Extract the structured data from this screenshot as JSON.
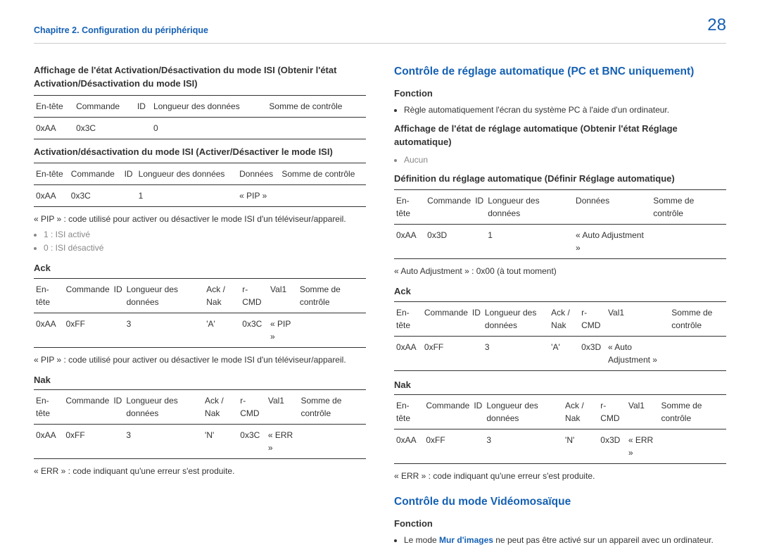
{
  "page_number": "28",
  "chapter": "Chapitre 2. Configuration du périphérique",
  "left": {
    "s1": {
      "title": "Affichage de l'état Activation/Désactivation du mode ISI (Obtenir l'état Activation/Désactivation du mode ISI)",
      "headers": [
        "En-tête",
        "Commande",
        "ID",
        "Longueur des données",
        "Somme de contrôle"
      ],
      "row": [
        "0xAA",
        "0x3C",
        "",
        "0",
        ""
      ]
    },
    "s2": {
      "title": "Activation/désactivation du mode ISI (Activer/Désactiver le mode ISI)",
      "headers": [
        "En-tête",
        "Commande",
        "ID",
        "Longueur des données",
        "Données",
        "Somme de contrôle"
      ],
      "row": [
        "0xAA",
        "0x3C",
        "",
        "1",
        "« PIP »",
        ""
      ],
      "note": "« PIP » : code utilisé pour activer ou désactiver le mode ISI d'un téléviseur/appareil.",
      "values": [
        "1 : ISI activé",
        "0 : ISI désactivé"
      ]
    },
    "ack": {
      "title": "Ack",
      "headers": [
        "En-tête",
        "Commande",
        "ID",
        "Longueur des données",
        "Ack / Nak",
        "r-CMD",
        "Val1",
        "Somme de contrôle"
      ],
      "row": [
        "0xAA",
        "0xFF",
        "",
        "3",
        "'A'",
        "0x3C",
        "« PIP »",
        ""
      ],
      "note": "« PIP » : code utilisé pour activer ou désactiver le mode ISI d'un téléviseur/appareil."
    },
    "nak": {
      "title": "Nak",
      "headers": [
        "En-tête",
        "Commande",
        "ID",
        "Longueur des données",
        "Ack / Nak",
        "r-CMD",
        "Val1",
        "Somme de contrôle"
      ],
      "row": [
        "0xAA",
        "0xFF",
        "",
        "3",
        "'N'",
        "0x3C",
        "« ERR »",
        ""
      ],
      "note": "« ERR » : code indiquant qu'une erreur s'est produite."
    }
  },
  "right": {
    "h1": "Contrôle de réglage automatique (PC et BNC uniquement)",
    "func": "Fonction",
    "func_item": "Règle automatiquement l'écran du système PC à l'aide d'un ordinateur.",
    "disp_title": "Affichage de l'état de réglage automatique (Obtenir l'état Réglage automatique)",
    "disp_item": "Aucun",
    "def": {
      "title": "Définition du réglage automatique (Définir Réglage automatique)",
      "headers": [
        "En-tête",
        "Commande",
        "ID",
        "Longueur des données",
        "Données",
        "Somme de contrôle"
      ],
      "row": [
        "0xAA",
        "0x3D",
        "",
        "1",
        "« Auto Adjustment »",
        ""
      ],
      "note": "« Auto Adjustment » : 0x00 (à tout moment)"
    },
    "ack": {
      "title": "Ack",
      "headers": [
        "En-tête",
        "Commande",
        "ID",
        "Longueur des données",
        "Ack / Nak",
        "r-CMD",
        "Val1",
        "Somme de contrôle"
      ],
      "row": [
        "0xAA",
        "0xFF",
        "",
        "3",
        "'A'",
        "0x3D",
        "« Auto Adjustment »",
        ""
      ]
    },
    "nak": {
      "title": "Nak",
      "headers": [
        "En-tête",
        "Commande",
        "ID",
        "Longueur des données",
        "Ack / Nak",
        "r-CMD",
        "Val1",
        "Somme de contrôle"
      ],
      "row": [
        "0xAA",
        "0xFF",
        "",
        "3",
        "'N'",
        "0x3D",
        "« ERR »",
        ""
      ],
      "note": "« ERR » : code indiquant qu'une erreur s'est produite."
    },
    "h2": "Contrôle du mode Vidéomosaïque",
    "func2": "Fonction",
    "func2_pre": "Le mode",
    "func2_link": "Mur d'images",
    "func2_post": "ne peut pas être activé sur un appareil avec un ordinateur."
  }
}
